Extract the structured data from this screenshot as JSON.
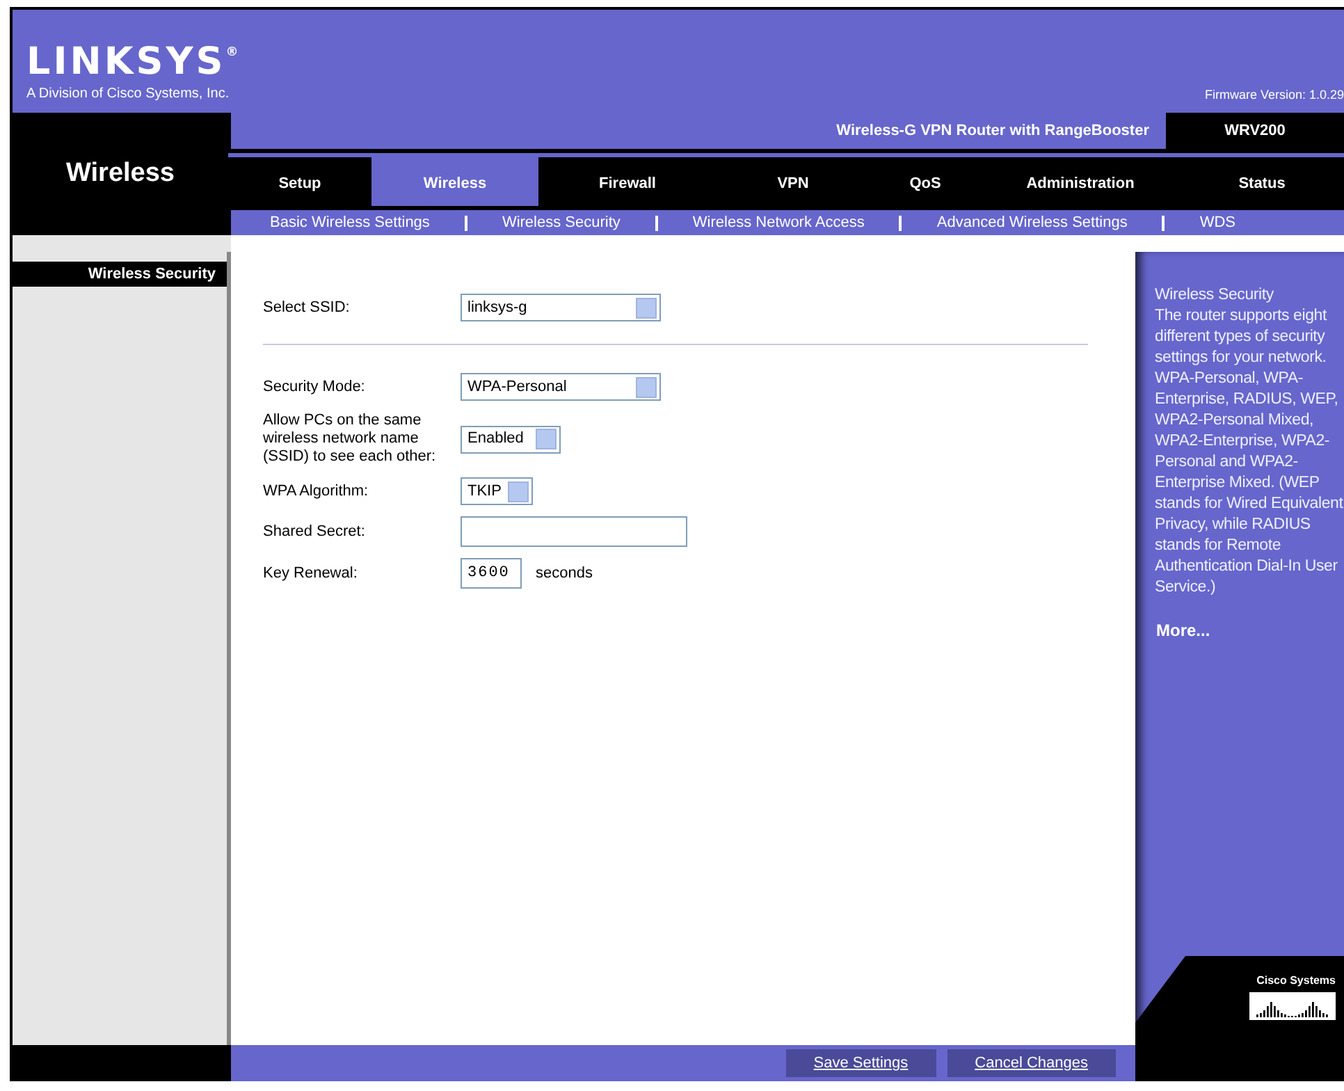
{
  "header": {
    "logo": "LINKSYS$^{®}$",
    "tagline": "A Division of Cisco Systems, Inc.",
    "firmware": "Firmware Version: 1.0.29"
  },
  "product": {
    "name": "Wireless-G VPN Router with RangeBooster",
    "model": "WRV200"
  },
  "section_title": "Wireless",
  "tabs": [
    {
      "label": "Setup",
      "selected": false
    },
    {
      "label": "Wireless",
      "selected": true
    },
    {
      "label": "Firewall",
      "selected": false
    },
    {
      "label": "VPN",
      "selected": false
    },
    {
      "label": "QoS",
      "selected": false
    },
    {
      "label": "Administration",
      "selected": false
    },
    {
      "label": "Status",
      "selected": false
    }
  ],
  "subtabs": [
    "Basic Wireless Settings",
    "Wireless Security",
    "Wireless Network Access",
    "Advanced Wireless Settings",
    "WDS"
  ],
  "sidebar": {
    "heading": "Wireless Security"
  },
  "form": [
    {
      "kind": "select",
      "label": "Select SSID:",
      "value": "linksys-g"
    },
    {
      "kind": "divider"
    },
    {
      "kind": "select",
      "label": "Security Mode:",
      "value": "WPA-Personal"
    },
    {
      "kind": "select",
      "label": "Allow PCs on the same wireless network name (SSID) to see each other:",
      "value": "Enabled"
    },
    {
      "kind": "select",
      "label": "WPA Algorithm:",
      "value": "TKIP"
    },
    {
      "kind": "text",
      "label": "Shared Secret:"
    },
    {
      "kind": "number",
      "label": "Key Renewal:",
      "value": "3600",
      "unit": "seconds"
    }
  ],
  "help": {
    "title": "Wireless Security",
    "text": "The router supports eight different types of security settings for your network. WPA-Personal, WPA-Enterprise, RADIUS, WEP, WPA2-Personal Mixed, WPA2-Enterprise, WPA2-Personal and WPA2-Enterprise Mixed. (WEP stands for Wired Equivalent Privacy, while RADIUS stands for Remote Authentication Dial-In User Service.)",
    "more": "More..."
  },
  "buttons": [
    "Save Settings",
    "Cancel Changes"
  ],
  "footer_logo": "Cisco Systems"
}
